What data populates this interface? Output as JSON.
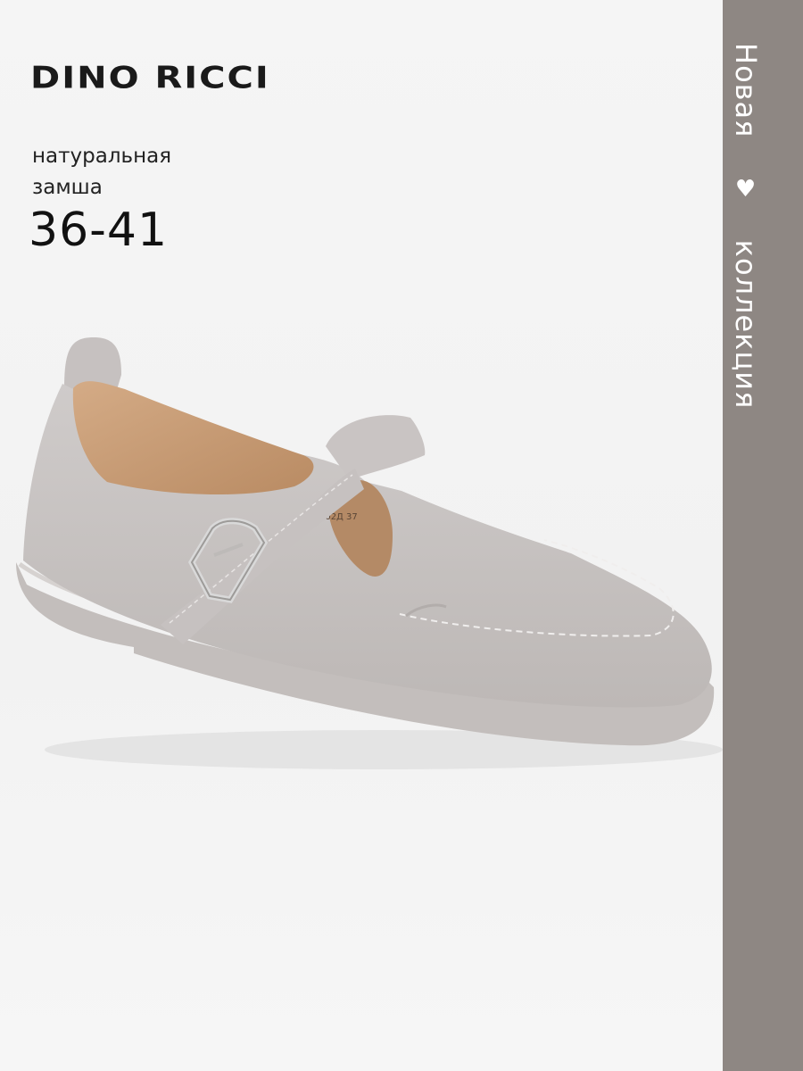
{
  "brand": {
    "name": "DINO RICCI"
  },
  "product": {
    "material_line1": "натуральная",
    "material_line2": "замша",
    "sizes": "36-41",
    "label_text": "7-102Д 37"
  },
  "sidebar": {
    "word1": "Новая",
    "word2": "коллекция",
    "heart_icon": "heart-icon"
  },
  "colors": {
    "sidebar_bg": "#8e8783",
    "suede": "#c9c5c4",
    "sole": "#c3bebc",
    "lining": "#c69b76"
  }
}
